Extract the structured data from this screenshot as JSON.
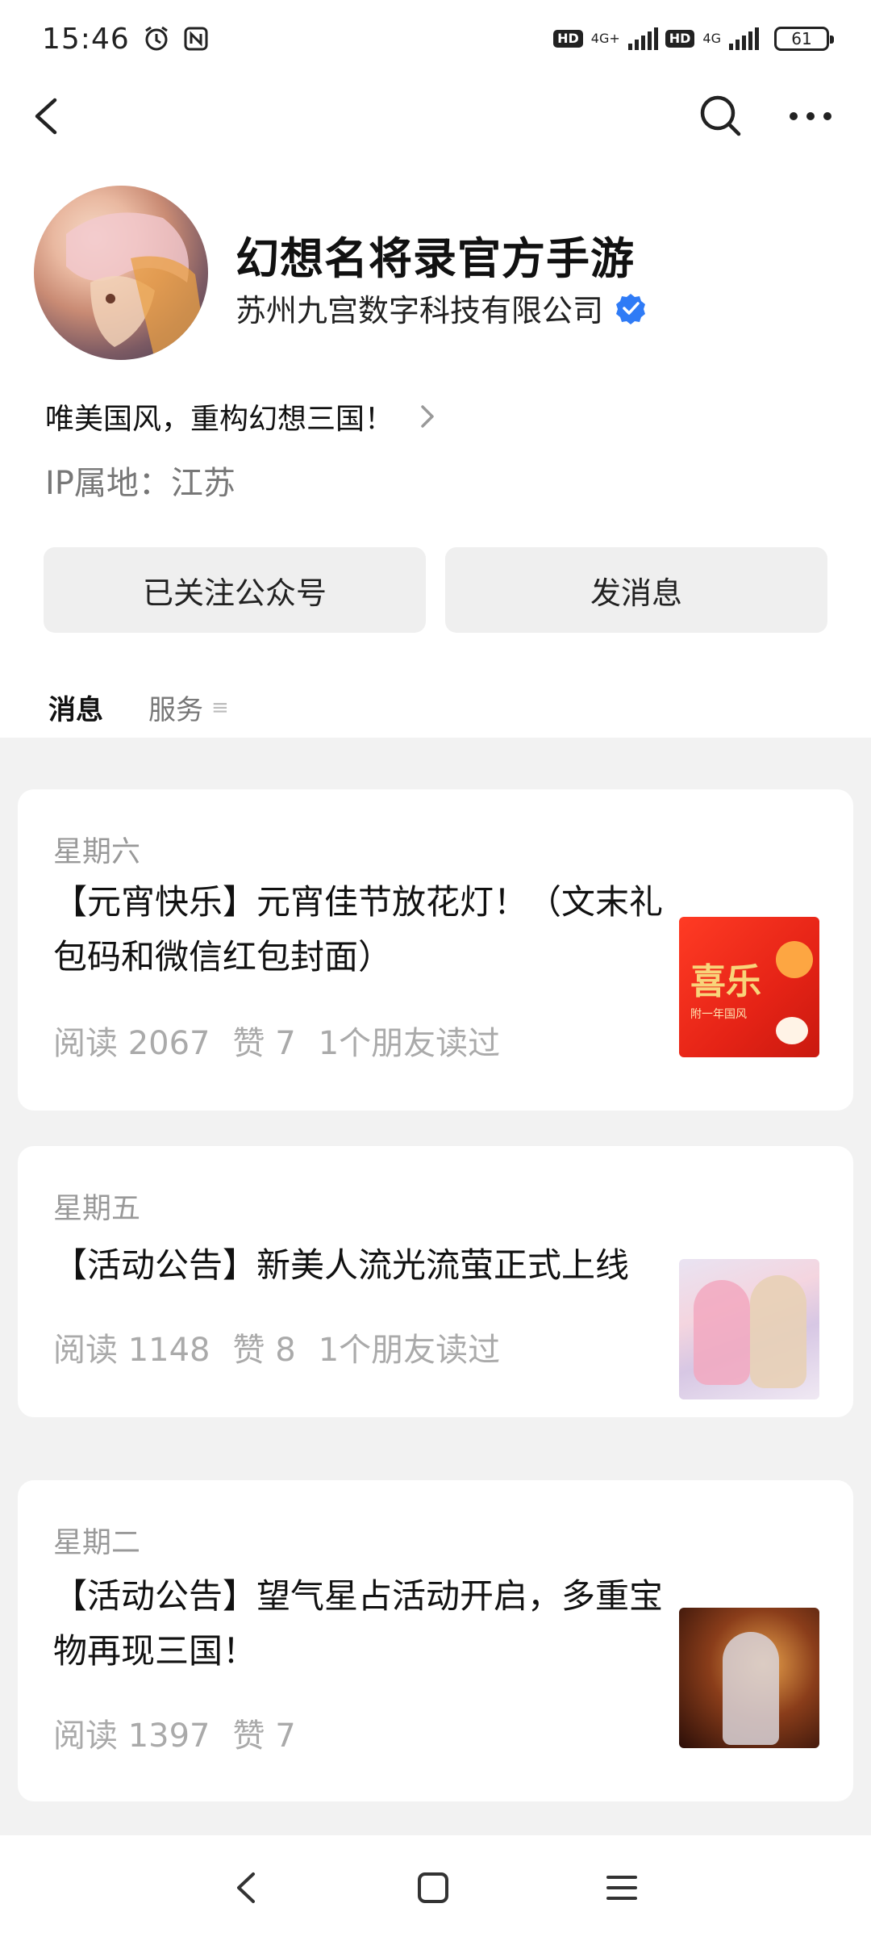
{
  "status_bar": {
    "time": "15:46",
    "net1": "4G+",
    "net2": "4G",
    "hd": "HD",
    "battery": "61"
  },
  "account": {
    "name": "幻想名将录官方手游",
    "company": "苏州九宫数字科技有限公司",
    "intro": "唯美国风，重构幻想三国！",
    "ip_location": "IP属地：江苏"
  },
  "actions": {
    "follow_label": "已关注公众号",
    "message_label": "发消息"
  },
  "tabs": {
    "messages": "消息",
    "services": "服务",
    "services_glyph": "≡"
  },
  "articles": [
    {
      "day": "星期六",
      "title": "【元宵快乐】元宵佳节放花灯！（文末礼包码和微信红包封面）",
      "reads": "阅读 2067",
      "likes": "赞 7",
      "friends": "1个朋友读过",
      "thumb_text": "喜乐",
      "thumb_sub": "附一年国风"
    },
    {
      "day": "星期五",
      "title": "【活动公告】新美人流光流萤正式上线",
      "reads": "阅读 1148",
      "likes": "赞 8",
      "friends": "1个朋友读过"
    },
    {
      "day": "星期二",
      "title": "【活动公告】望气星占活动开启，多重宝物再现三国！",
      "reads": "阅读 1397",
      "likes": "赞 7"
    }
  ],
  "colors": {
    "verified": "#2f7bf6",
    "feed_bg": "#f2f2f2",
    "button_bg": "#efefef"
  }
}
